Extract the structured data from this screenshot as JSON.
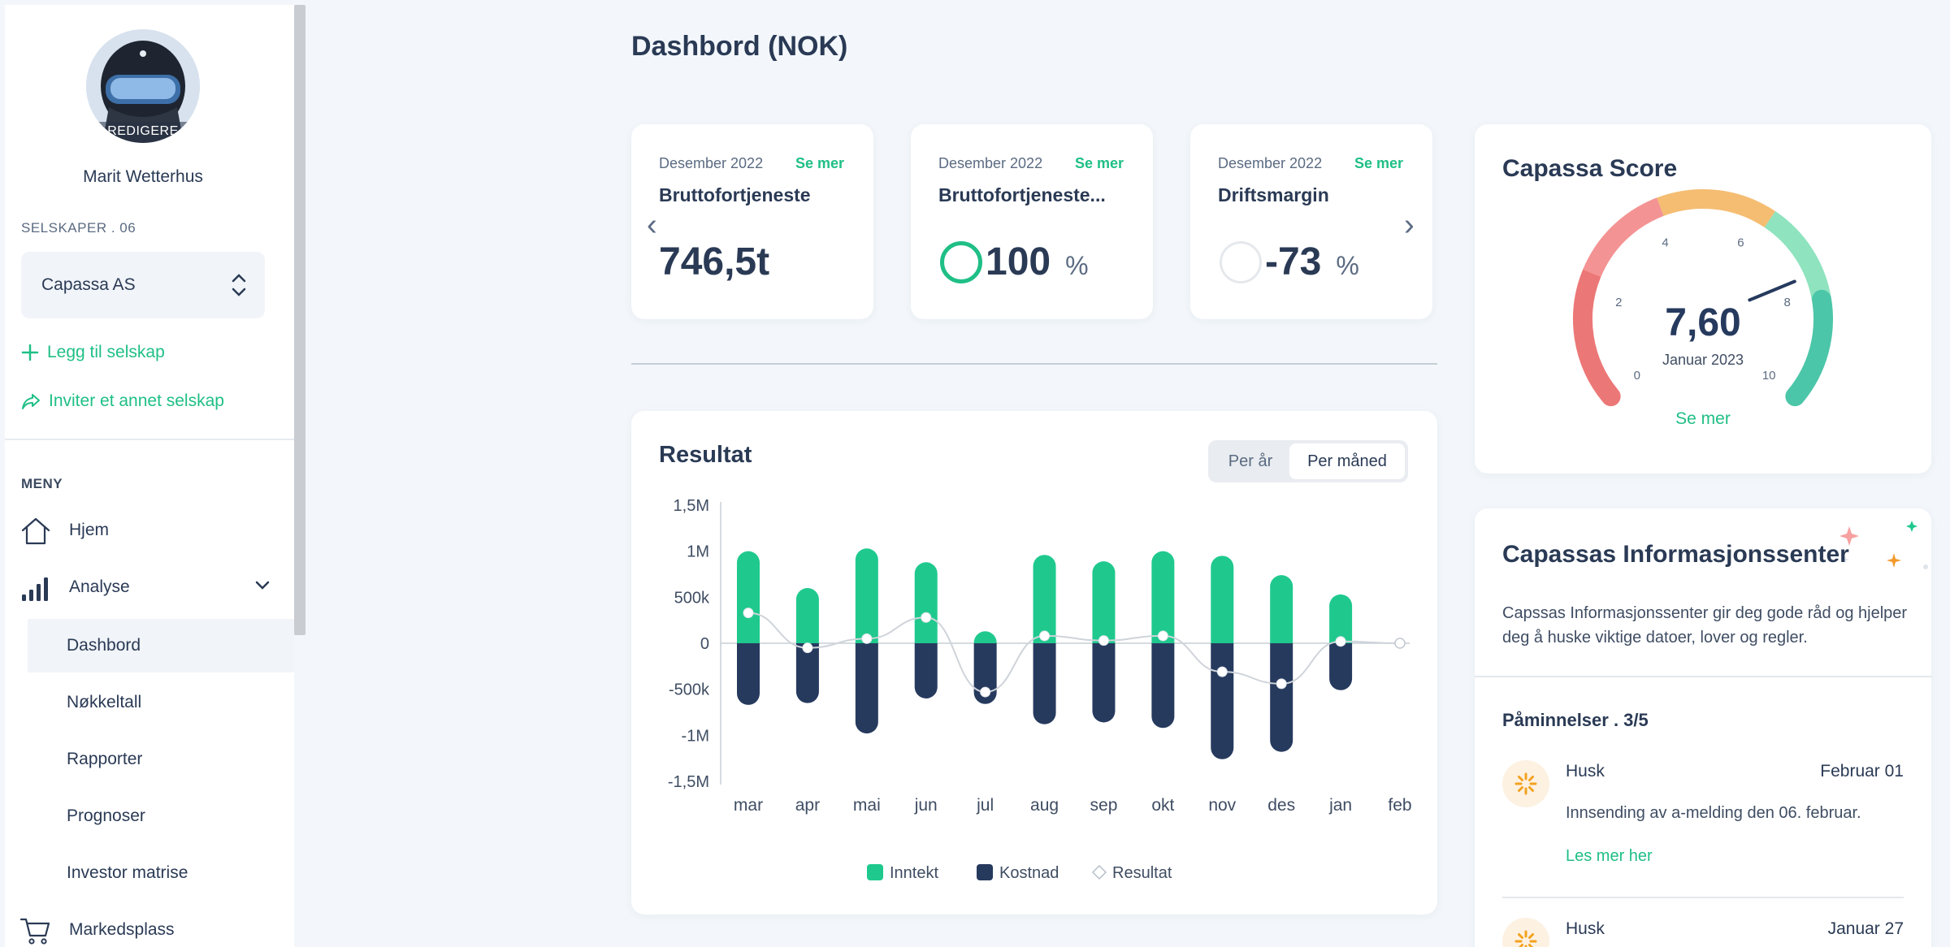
{
  "sidebar": {
    "avatar_edit_label": "REDIGERE",
    "user_name": "Marit Wetterhus",
    "companies_label": "SELSKAPER . 06",
    "selected_company": "Capassa AS",
    "add_company": "Legg til selskap",
    "invite_company": "Inviter et annet selskap",
    "menu_label": "MENY",
    "menu": {
      "home": "Hjem",
      "analysis": "Analyse",
      "dashboard": "Dashbord",
      "key_figures": "Nøkkeltall",
      "reports": "Rapporter",
      "forecasts": "Prognoser",
      "investor_matrix": "Investor matrise",
      "marketplace": "Markedsplass"
    }
  },
  "page": {
    "title": "Dashbord (NOK)"
  },
  "kpis": [
    {
      "date": "Desember 2022",
      "more": "Se mer",
      "title": "Bruttofortjeneste",
      "value": "746,5t",
      "unit": ""
    },
    {
      "date": "Desember 2022",
      "more": "Se mer",
      "title": "Bruttofortjeneste...",
      "value": "100",
      "unit": "%"
    },
    {
      "date": "Desember 2022",
      "more": "Se mer",
      "title": "Driftsmargin",
      "value": "-73",
      "unit": "%"
    }
  ],
  "result_chart": {
    "title": "Resultat",
    "toggle": {
      "per_year": "Per år",
      "per_month": "Per måned",
      "selected": "Per måned"
    },
    "colors": {
      "income": "#1fc98e",
      "cost": "#263a5e",
      "result": "#cfd4da"
    }
  },
  "chart_data": {
    "type": "bar",
    "categories": [
      "mar",
      "apr",
      "mai",
      "jun",
      "jul",
      "aug",
      "sep",
      "okt",
      "nov",
      "des",
      "jan",
      "feb"
    ],
    "series": [
      {
        "name": "Inntekt",
        "values": [
          1000000,
          600000,
          1030000,
          880000,
          130000,
          960000,
          890000,
          1000000,
          950000,
          740000,
          530000,
          0
        ]
      },
      {
        "name": "Kostnad",
        "values": [
          -670000,
          -650000,
          -980000,
          -600000,
          -660000,
          -880000,
          -860000,
          -920000,
          -1260000,
          -1180000,
          -510000,
          0
        ]
      },
      {
        "name": "Resultat",
        "values": [
          330000,
          -50000,
          50000,
          280000,
          -530000,
          80000,
          30000,
          80000,
          -310000,
          -440000,
          20000,
          0
        ]
      }
    ],
    "ylim": [
      -1500000,
      1500000
    ],
    "yticks": [
      "1,5M",
      "1M",
      "500k",
      "0",
      "-500k",
      "-1M",
      "-1,5M"
    ],
    "legend": [
      "Inntekt",
      "Kostnad",
      "Resultat"
    ],
    "legend_position": "bottom"
  },
  "score": {
    "title": "Capassa Score",
    "value": "7,60",
    "value_num": 7.6,
    "period": "Januar 2023",
    "scale": [
      "0",
      "2",
      "4",
      "6",
      "8",
      "10"
    ],
    "more": "Se mer"
  },
  "info": {
    "title": "Capassas Informasjonssenter",
    "description": "Capssas Informasjonssenter gir deg gode råd og hjelper deg å huske viktige datoer, lover og regler.",
    "reminders_title": "Påminnelser . 3/5",
    "reminders": [
      {
        "name": "Husk",
        "date": "Februar 01",
        "text": "Innsending av a-melding den 06. februar.",
        "link": "Les mer her"
      },
      {
        "name": "Husk",
        "date": "Januar 27"
      }
    ]
  }
}
